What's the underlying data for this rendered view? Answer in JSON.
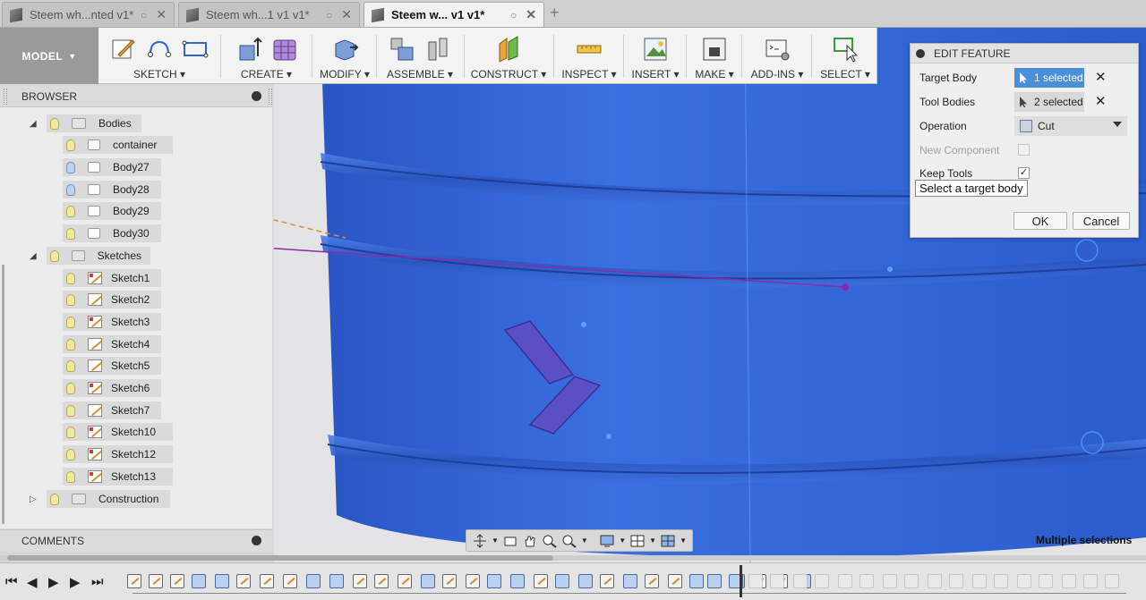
{
  "tabs": [
    {
      "title": "Steem wh...nted v1*",
      "active": false
    },
    {
      "title": "Steem wh...1 v1 v1*",
      "active": false
    },
    {
      "title": "Steem w... v1 v1*",
      "active": true
    }
  ],
  "toolbar": {
    "workspace": "MODEL",
    "groups": [
      "SKETCH",
      "CREATE",
      "MODIFY",
      "ASSEMBLE",
      "CONSTRUCT",
      "INSPECT",
      "INSERT",
      "MAKE",
      "ADD-INS",
      "SELECT"
    ]
  },
  "browser": {
    "title": "BROWSER",
    "bodies_folder": "Bodies",
    "bodies": [
      "container",
      "Body27",
      "Body28",
      "Body29",
      "Body30"
    ],
    "sketches_folder": "Sketches",
    "sketches": [
      "Sketch1",
      "Sketch2",
      "Sketch3",
      "Sketch4",
      "Sketch5",
      "Sketch6",
      "Sketch7",
      "Sketch10",
      "Sketch12",
      "Sketch13"
    ],
    "construction_folder": "Construction"
  },
  "comments": {
    "title": "COMMENTS"
  },
  "dialog": {
    "title": "EDIT FEATURE",
    "target_body_label": "Target Body",
    "target_body_value": "1 selected",
    "tool_bodies_label": "Tool Bodies",
    "tool_bodies_value": "2 selected",
    "operation_label": "Operation",
    "operation_value": "Cut",
    "new_component_label": "New Component",
    "keep_tools_label": "Keep Tools",
    "keep_tools_checked": "✓",
    "tooltip": "Select a target body",
    "ok_label": "OK",
    "cancel_label": "Cancel"
  },
  "status": {
    "selection": "Multiple selections"
  },
  "colors": {
    "model_blue": "#2d5fd0",
    "selection_blue": "#4a8fd8"
  }
}
